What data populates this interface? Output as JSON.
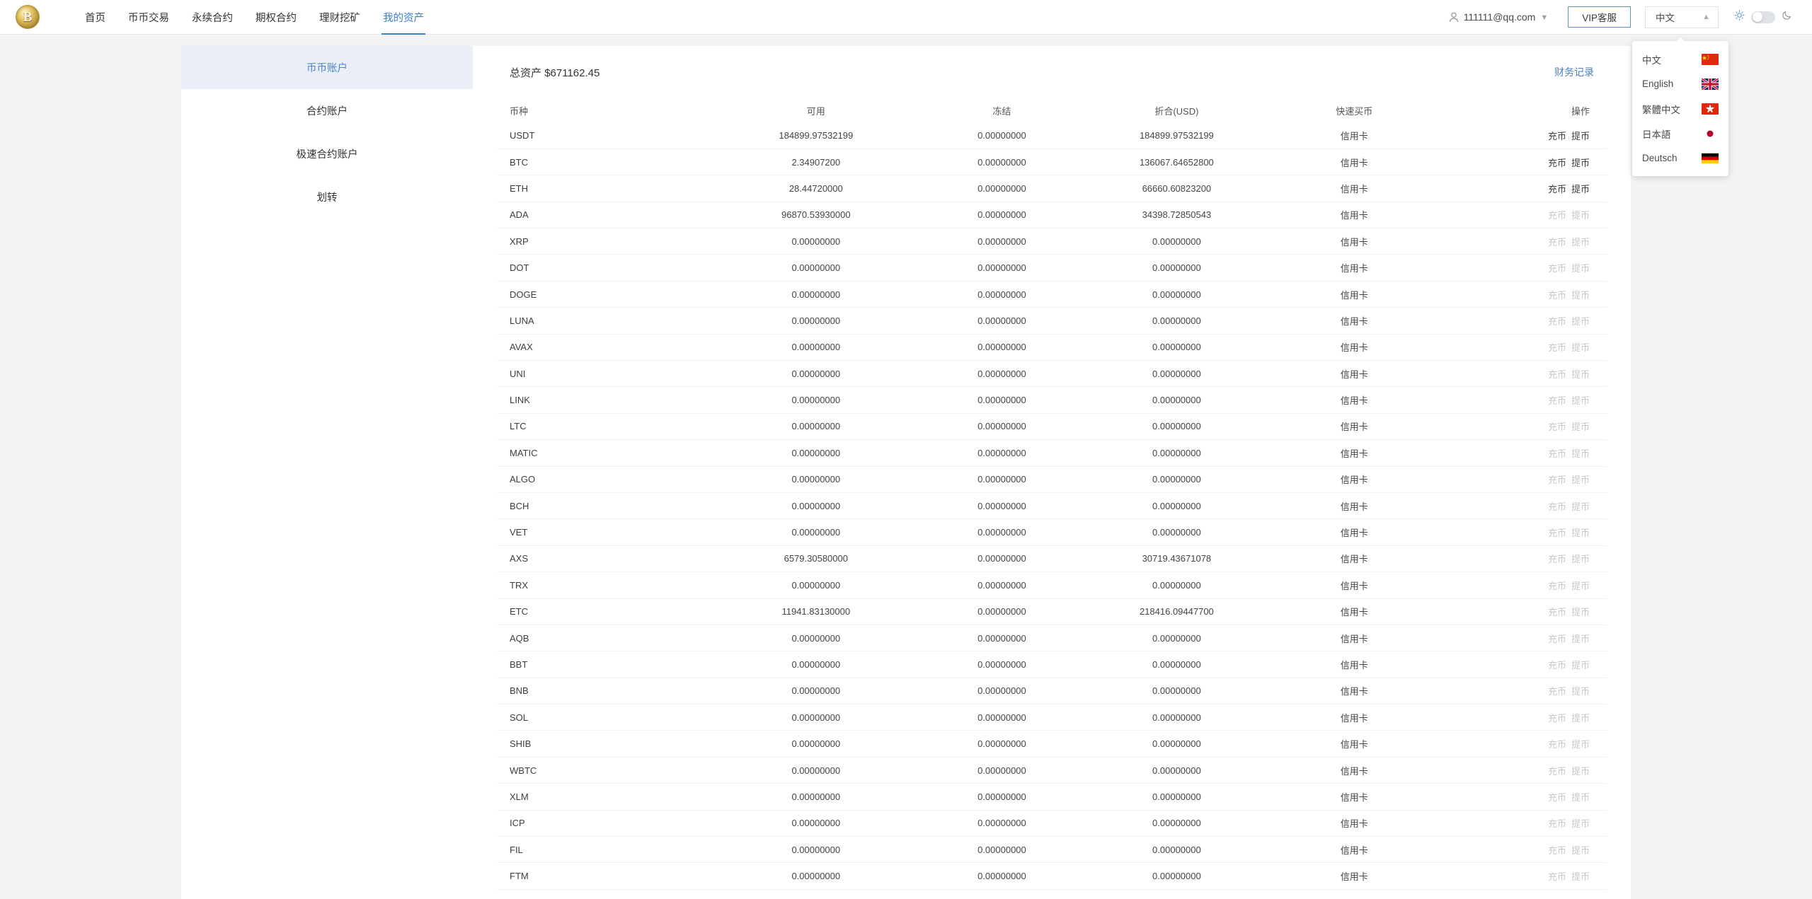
{
  "header": {
    "logo_icon": "bitcoin-coin-logo",
    "logo_letter": "B",
    "nav": [
      {
        "label": "首页",
        "active": false
      },
      {
        "label": "币币交易",
        "active": false
      },
      {
        "label": "永续合约",
        "active": false
      },
      {
        "label": "期权合约",
        "active": false
      },
      {
        "label": "理财挖矿",
        "active": false
      },
      {
        "label": "我的资产",
        "active": true
      }
    ],
    "user": {
      "email": "111111@qq.com",
      "icon": "user-icon",
      "caret": "⌄"
    },
    "vip_button": "VIP客服",
    "language": {
      "selected": "中文",
      "chevron": "︿"
    },
    "theme": {
      "sun_icon": "sun-icon",
      "moon_icon": "moon-icon",
      "state": "light"
    }
  },
  "language_menu": {
    "items": [
      {
        "label": "中文",
        "flag": "cn"
      },
      {
        "label": "English",
        "flag": "uk"
      },
      {
        "label": "繁體中文",
        "flag": "hk"
      },
      {
        "label": "日本語",
        "flag": "jp"
      },
      {
        "label": "Deutsch",
        "flag": "de"
      }
    ]
  },
  "sidebar": {
    "items": [
      {
        "label": "币币账户",
        "active": true
      },
      {
        "label": "合约账户",
        "active": false
      },
      {
        "label": "极速合约账户",
        "active": false
      },
      {
        "label": "划转",
        "active": false
      }
    ]
  },
  "main": {
    "total_assets_label": "总资产",
    "total_assets_value": "$671162.45",
    "financial_record_link": "财务记录",
    "columns": [
      "币种",
      "可用",
      "冻结",
      "折合(USD)",
      "快速买币",
      "操作"
    ],
    "buy_label": "信用卡",
    "op_deposit": "充币",
    "op_withdraw": "提币",
    "rows": [
      {
        "coin": "USDT",
        "available": "184899.97532199",
        "frozen": "0.00000000",
        "usd": "184899.97532199",
        "buy": "信用卡",
        "ops_enabled": true
      },
      {
        "coin": "BTC",
        "available": "2.34907200",
        "frozen": "0.00000000",
        "usd": "136067.64652800",
        "buy": "信用卡",
        "ops_enabled": true
      },
      {
        "coin": "ETH",
        "available": "28.44720000",
        "frozen": "0.00000000",
        "usd": "66660.60823200",
        "buy": "信用卡",
        "ops_enabled": true
      },
      {
        "coin": "ADA",
        "available": "96870.53930000",
        "frozen": "0.00000000",
        "usd": "34398.72850543",
        "buy": "信用卡",
        "ops_enabled": false
      },
      {
        "coin": "XRP",
        "available": "0.00000000",
        "frozen": "0.00000000",
        "usd": "0.00000000",
        "buy": "信用卡",
        "ops_enabled": false
      },
      {
        "coin": "DOT",
        "available": "0.00000000",
        "frozen": "0.00000000",
        "usd": "0.00000000",
        "buy": "信用卡",
        "ops_enabled": false
      },
      {
        "coin": "DOGE",
        "available": "0.00000000",
        "frozen": "0.00000000",
        "usd": "0.00000000",
        "buy": "信用卡",
        "ops_enabled": false
      },
      {
        "coin": "LUNA",
        "available": "0.00000000",
        "frozen": "0.00000000",
        "usd": "0.00000000",
        "buy": "信用卡",
        "ops_enabled": false
      },
      {
        "coin": "AVAX",
        "available": "0.00000000",
        "frozen": "0.00000000",
        "usd": "0.00000000",
        "buy": "信用卡",
        "ops_enabled": false
      },
      {
        "coin": "UNI",
        "available": "0.00000000",
        "frozen": "0.00000000",
        "usd": "0.00000000",
        "buy": "信用卡",
        "ops_enabled": false
      },
      {
        "coin": "LINK",
        "available": "0.00000000",
        "frozen": "0.00000000",
        "usd": "0.00000000",
        "buy": "信用卡",
        "ops_enabled": false
      },
      {
        "coin": "LTC",
        "available": "0.00000000",
        "frozen": "0.00000000",
        "usd": "0.00000000",
        "buy": "信用卡",
        "ops_enabled": false
      },
      {
        "coin": "MATIC",
        "available": "0.00000000",
        "frozen": "0.00000000",
        "usd": "0.00000000",
        "buy": "信用卡",
        "ops_enabled": false
      },
      {
        "coin": "ALGO",
        "available": "0.00000000",
        "frozen": "0.00000000",
        "usd": "0.00000000",
        "buy": "信用卡",
        "ops_enabled": false
      },
      {
        "coin": "BCH",
        "available": "0.00000000",
        "frozen": "0.00000000",
        "usd": "0.00000000",
        "buy": "信用卡",
        "ops_enabled": false
      },
      {
        "coin": "VET",
        "available": "0.00000000",
        "frozen": "0.00000000",
        "usd": "0.00000000",
        "buy": "信用卡",
        "ops_enabled": false
      },
      {
        "coin": "AXS",
        "available": "6579.30580000",
        "frozen": "0.00000000",
        "usd": "30719.43671078",
        "buy": "信用卡",
        "ops_enabled": false
      },
      {
        "coin": "TRX",
        "available": "0.00000000",
        "frozen": "0.00000000",
        "usd": "0.00000000",
        "buy": "信用卡",
        "ops_enabled": false
      },
      {
        "coin": "ETC",
        "available": "11941.83130000",
        "frozen": "0.00000000",
        "usd": "218416.09447700",
        "buy": "信用卡",
        "ops_enabled": false
      },
      {
        "coin": "AQB",
        "available": "0.00000000",
        "frozen": "0.00000000",
        "usd": "0.00000000",
        "buy": "信用卡",
        "ops_enabled": false
      },
      {
        "coin": "BBT",
        "available": "0.00000000",
        "frozen": "0.00000000",
        "usd": "0.00000000",
        "buy": "信用卡",
        "ops_enabled": false
      },
      {
        "coin": "BNB",
        "available": "0.00000000",
        "frozen": "0.00000000",
        "usd": "0.00000000",
        "buy": "信用卡",
        "ops_enabled": false
      },
      {
        "coin": "SOL",
        "available": "0.00000000",
        "frozen": "0.00000000",
        "usd": "0.00000000",
        "buy": "信用卡",
        "ops_enabled": false
      },
      {
        "coin": "SHIB",
        "available": "0.00000000",
        "frozen": "0.00000000",
        "usd": "0.00000000",
        "buy": "信用卡",
        "ops_enabled": false
      },
      {
        "coin": "WBTC",
        "available": "0.00000000",
        "frozen": "0.00000000",
        "usd": "0.00000000",
        "buy": "信用卡",
        "ops_enabled": false
      },
      {
        "coin": "XLM",
        "available": "0.00000000",
        "frozen": "0.00000000",
        "usd": "0.00000000",
        "buy": "信用卡",
        "ops_enabled": false
      },
      {
        "coin": "ICP",
        "available": "0.00000000",
        "frozen": "0.00000000",
        "usd": "0.00000000",
        "buy": "信用卡",
        "ops_enabled": false
      },
      {
        "coin": "FIL",
        "available": "0.00000000",
        "frozen": "0.00000000",
        "usd": "0.00000000",
        "buy": "信用卡",
        "ops_enabled": false
      },
      {
        "coin": "FTM",
        "available": "0.00000000",
        "frozen": "0.00000000",
        "usd": "0.00000000",
        "buy": "信用卡",
        "ops_enabled": false
      }
    ]
  },
  "colors": {
    "accent": "#3c7fd0",
    "active_sidebar_bg": "#e9eef7",
    "page_bg": "#f2f3f5"
  }
}
